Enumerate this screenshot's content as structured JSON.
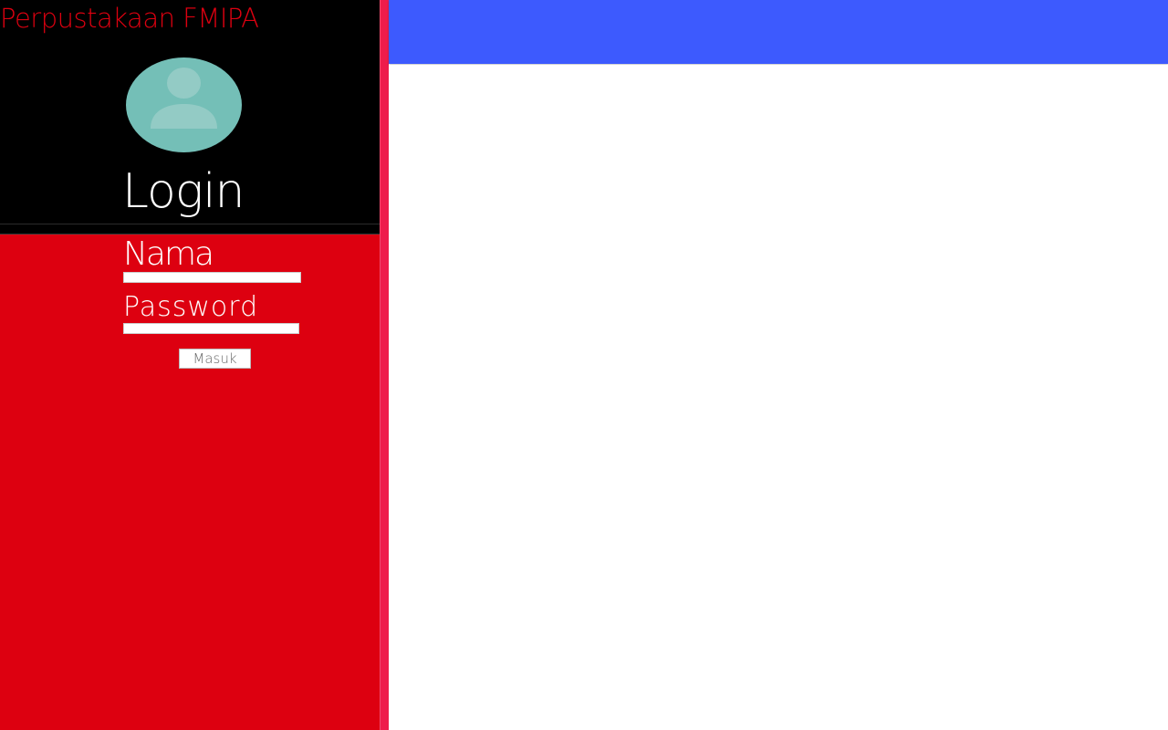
{
  "sidebar": {
    "site_title": "Perpustakaan FMIPA",
    "avatar_icon": "user-avatar-icon",
    "login_heading": "Login",
    "form": {
      "name_label": "Nama",
      "name_value": "",
      "password_label": "Password",
      "password_value": "",
      "submit_label": "Masuk"
    }
  },
  "colors": {
    "sidebar_header": "#000000",
    "sidebar_body": "#dd0010",
    "sidebar_edge": "#ee1c4b",
    "site_title": "#dd0010",
    "avatar": "#74bfb7",
    "topbar": "#3d5afe",
    "main": "#ffffff"
  }
}
